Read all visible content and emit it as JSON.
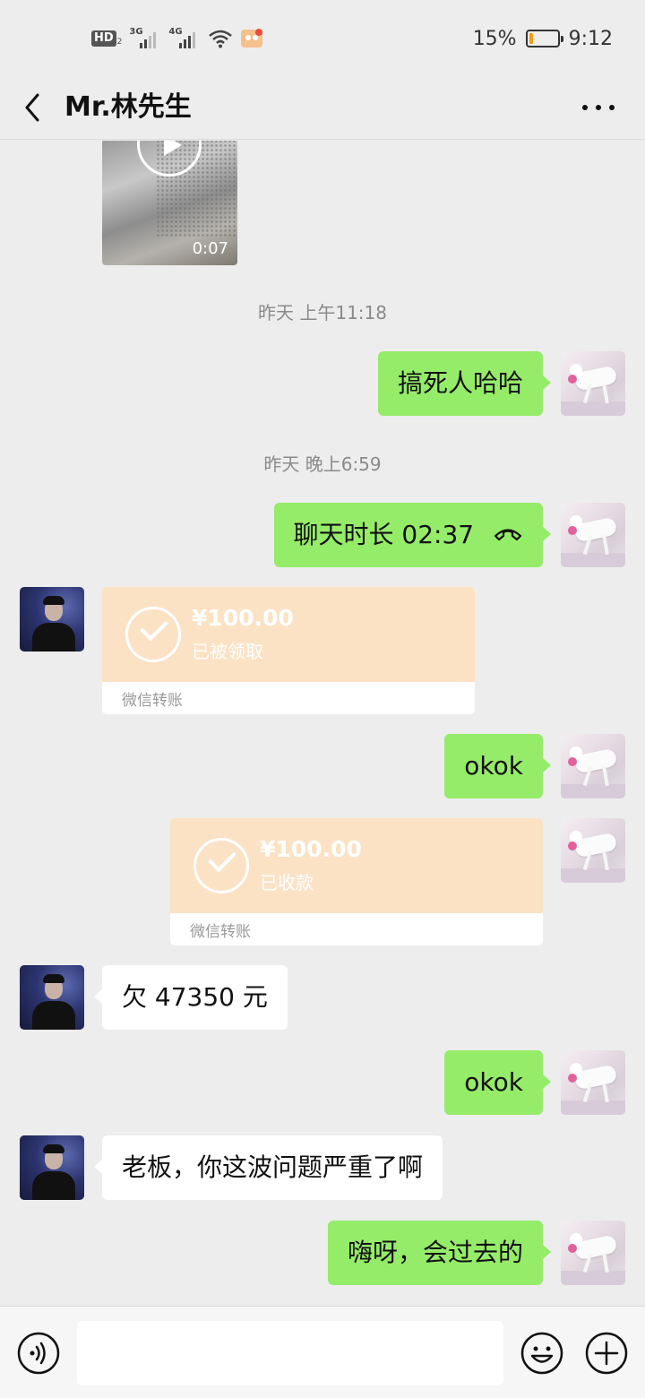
{
  "status_bar": {
    "hd_label": "HD",
    "hd_sub": "2",
    "signal1_label": "3G",
    "signal2_label": "4G",
    "battery_percent": "15%",
    "battery_level": 0.15,
    "time": "9:12"
  },
  "header": {
    "back_icon": "chevron-left-icon",
    "title": "Mr.林先生",
    "more_icon": "more-dots-icon"
  },
  "messages": {
    "video": {
      "duration": "0:07"
    },
    "ts1": "昨天 上午11:18",
    "m1": {
      "text": "搞死人哈哈"
    },
    "ts2": "昨天 晚上6:59",
    "m2": {
      "text": "聊天时长 02:37"
    },
    "t1": {
      "amount": "¥100.00",
      "status": "已被领取",
      "label": "微信转账"
    },
    "m3": {
      "text": "okok"
    },
    "t2": {
      "amount": "¥100.00",
      "status": "已收款",
      "label": "微信转账"
    },
    "m4": {
      "text": "欠 47350 元"
    },
    "m5": {
      "text": "okok"
    },
    "m6": {
      "text": "老板，你这波问题严重了啊"
    },
    "m7": {
      "text": "嗨呀，会过去的"
    }
  },
  "input_bar": {
    "voice_icon": "voice-icon",
    "text_value": "",
    "emoji_icon": "emoji-icon",
    "plus_icon": "plus-icon"
  },
  "colors": {
    "background": "#ededed",
    "my_bubble": "#95ec69",
    "other_bubble": "#ffffff",
    "transfer": "#fce2c5",
    "battery_fill": "#f39c12"
  }
}
